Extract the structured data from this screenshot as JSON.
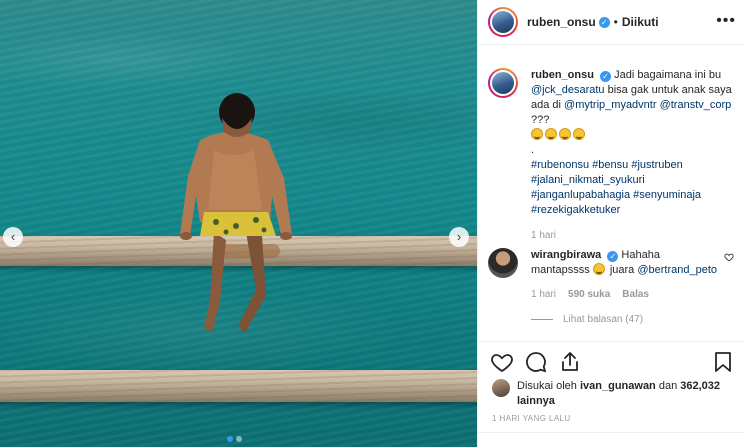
{
  "post": {
    "author": "ruben_onsu",
    "follow_state": "Diikuti",
    "separator": "•",
    "more_label": "•••"
  },
  "caption": {
    "username": "ruben_onsu",
    "line1": "Jadi bagaimana ini bu",
    "mention1": "@jck_desaratu",
    "line2": "bisa gak untuk anak saya ada di",
    "mention2": "@mytrip_myadvntr",
    "mention3": "@transtv_corp",
    "tail": "???",
    "emoji_count": 4,
    "dot": ".",
    "hashtags": [
      "#rubenonsu",
      "#bensu",
      "#justruben",
      "#jalani_nikmati_syukuri",
      "#janganlupabahagia",
      "#senyuminaja",
      "#rezekigakketuker"
    ],
    "time": "1 hari"
  },
  "comment": {
    "username": "wirangbirawa",
    "text1": "Hahaha mantapssss",
    "text2": "juara",
    "mention": "@bertrand_peto",
    "time": "1 hari",
    "likes": "590 suka",
    "reply_label": "Balas",
    "view_replies": "Lihat balasan (47)"
  },
  "likes": {
    "prefix": "Disukai oleh",
    "liker": "ivan_gunawan",
    "joiner": "dan",
    "others": "362,032 lainnya"
  },
  "timestamp": "1 HARI YANG LALU",
  "carousel": {
    "prev": "‹",
    "next": "›",
    "slides": 2,
    "active_slide": 1
  },
  "colors": {
    "link": "#003569",
    "verified": "#3897f0",
    "muted": "#999999",
    "water": "#14898c"
  }
}
